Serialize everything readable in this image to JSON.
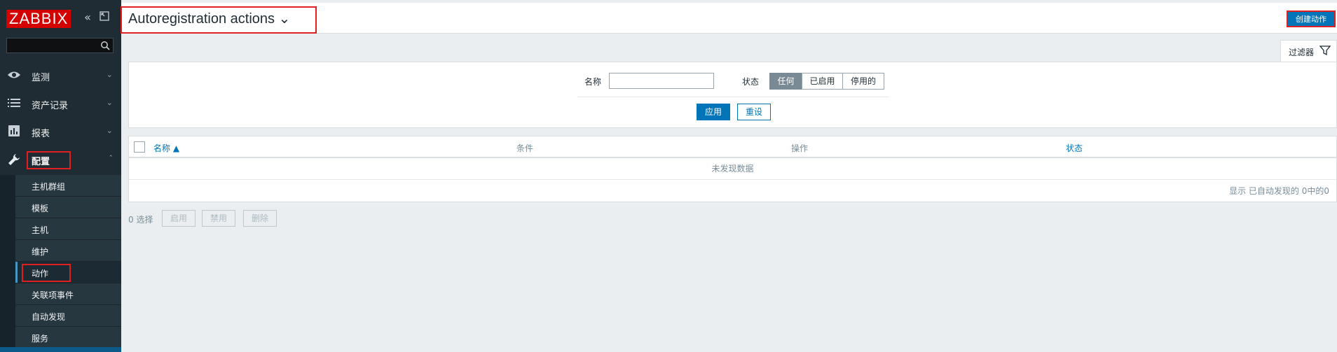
{
  "app": {
    "logo": "ZABBIX"
  },
  "sidebar": {
    "search": {
      "placeholder": ""
    },
    "menu": [
      {
        "label": "监测",
        "icon": "eye-icon"
      },
      {
        "label": "资产记录",
        "icon": "list-icon"
      },
      {
        "label": "报表",
        "icon": "bar-chart-icon"
      },
      {
        "label": "配置",
        "icon": "wrench-icon"
      }
    ],
    "submenu": [
      {
        "label": "主机群组"
      },
      {
        "label": "模板"
      },
      {
        "label": "主机"
      },
      {
        "label": "维护"
      },
      {
        "label": "动作"
      },
      {
        "label": "关联项事件"
      },
      {
        "label": "自动发现"
      },
      {
        "label": "服务"
      }
    ]
  },
  "header": {
    "title": "Autoregistration actions ⌄",
    "create_button": "创建动作"
  },
  "filter": {
    "tab_label": "过滤器",
    "name_label": "名称",
    "name_value": "",
    "status_label": "状态",
    "status_options": [
      "任何",
      "已启用",
      "停用的"
    ],
    "status_selected": "任何",
    "apply": "应用",
    "reset": "重设"
  },
  "table": {
    "columns": [
      "名称 ▲",
      "条件",
      "操作",
      "状态"
    ],
    "no_data": "未发现数据",
    "footer": "显示 已自动发现的 0中的0"
  },
  "mass_actions": {
    "selected": "0 选择",
    "buttons": [
      "启用",
      "禁用",
      "删除"
    ]
  },
  "colors": {
    "sidebar_bg": "#1f2c33",
    "accent": "#0275b8",
    "highlight_red": "#e02020",
    "logo_red": "#d40000"
  }
}
